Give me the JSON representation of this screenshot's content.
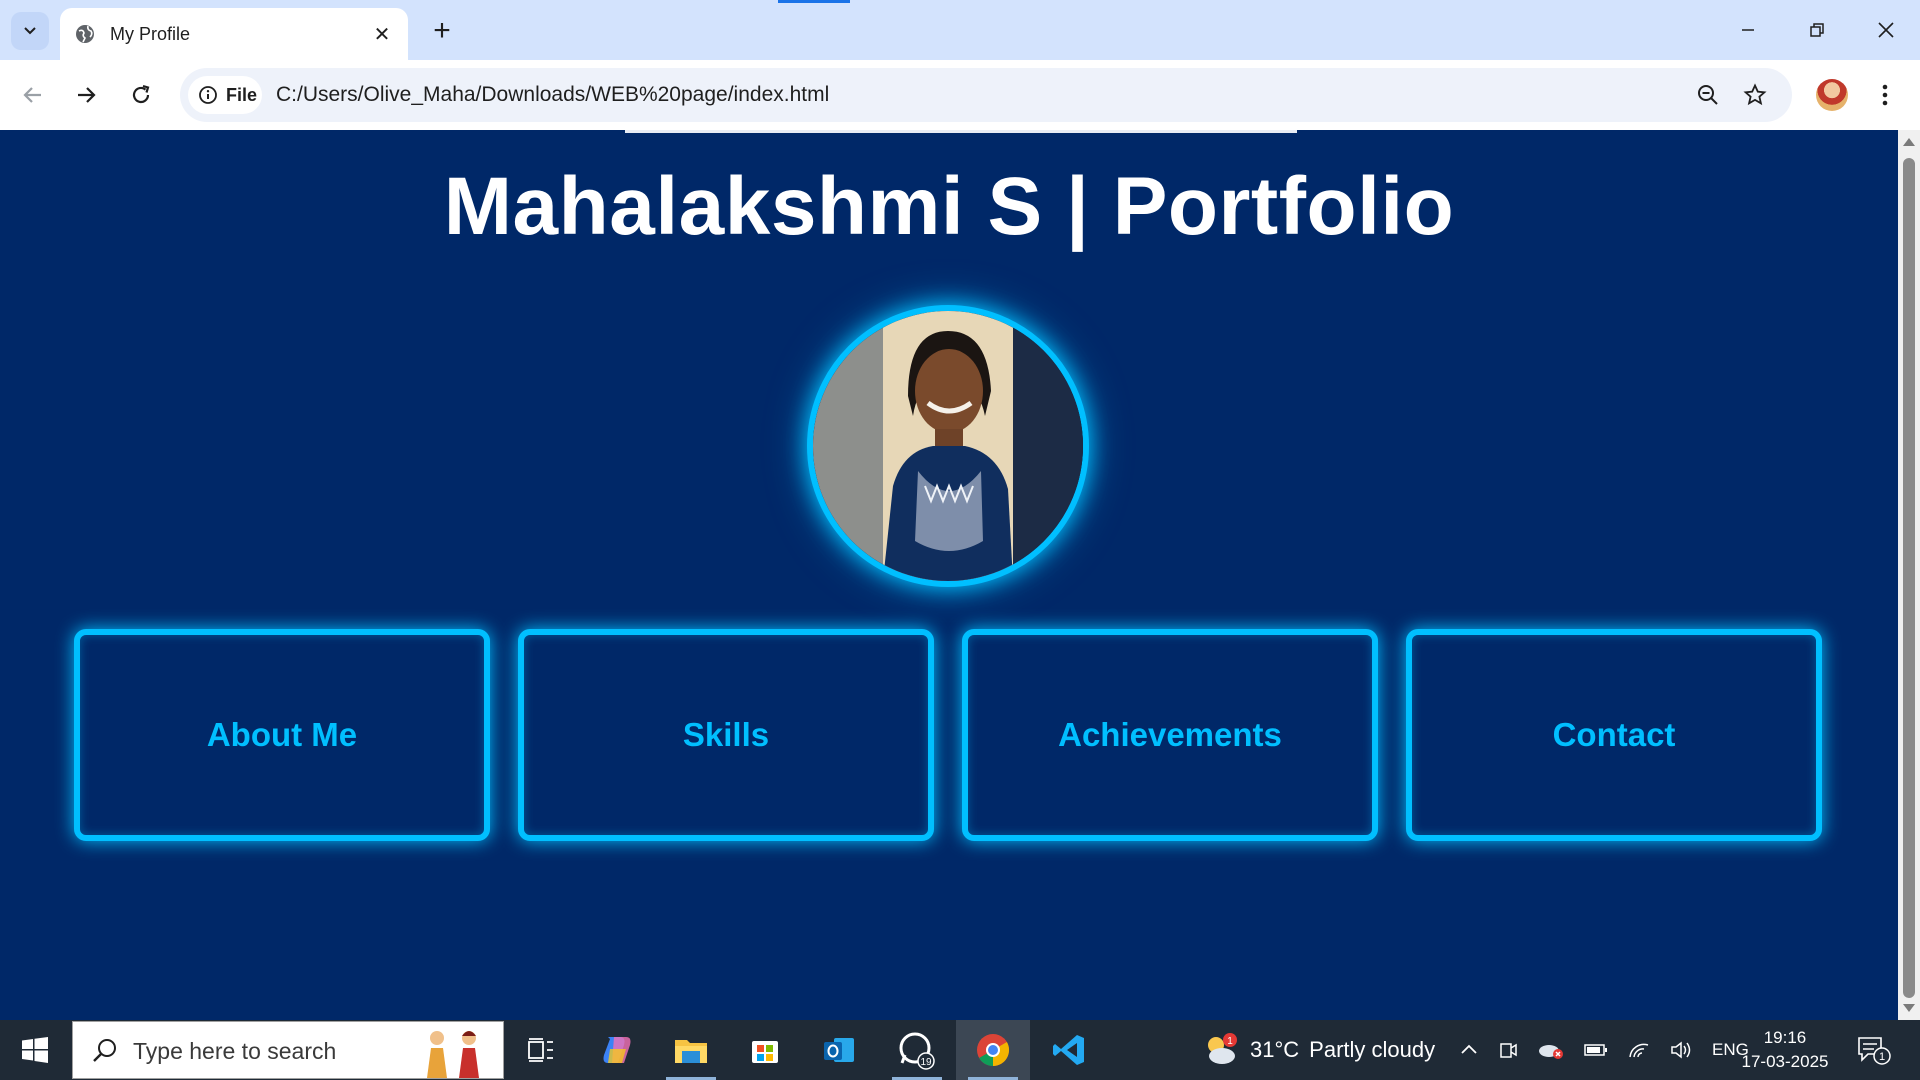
{
  "browser": {
    "tab_title": "My Profile",
    "new_tab_symbol": "+",
    "close_tab_symbol": "✕",
    "site_info_label": "File",
    "url": "C:/Users/Olive_Maha/Downloads/WEB%20page/index.html"
  },
  "page": {
    "title": "Mahalakshmi S | Portfolio",
    "profile_image_alt": "Profile photo",
    "nav_cards": [
      {
        "label": "About Me"
      },
      {
        "label": "Skills"
      },
      {
        "label": "Achievements"
      },
      {
        "label": "Contact"
      }
    ],
    "colors": {
      "background": "#002868",
      "accent": "#00bfff",
      "title": "#ffffff"
    }
  },
  "taskbar": {
    "search_placeholder": "Type here to search",
    "weather_temp": "31°C",
    "weather_desc": "Partly cloudy",
    "weather_badge": "1",
    "whatsapp_badge": "19",
    "language": "ENG",
    "time": "19:16",
    "date": "17-03-2025",
    "notification_count": "1"
  }
}
